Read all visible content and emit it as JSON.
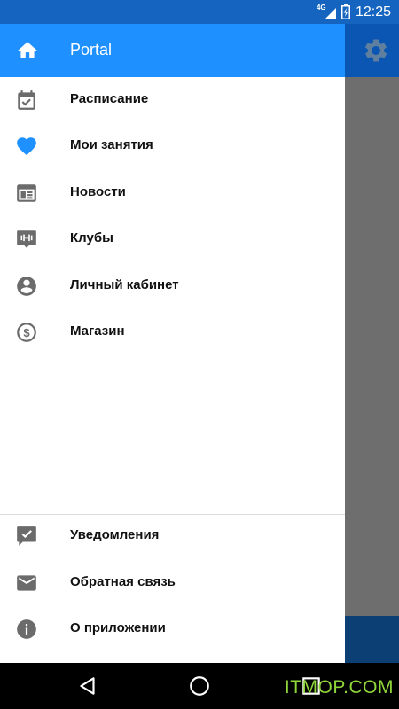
{
  "status_bar": {
    "network": "4G",
    "time": "12:25",
    "icons": [
      "signal-icon",
      "battery-charging-icon"
    ]
  },
  "drawer": {
    "header": {
      "title": "Portal",
      "icon": "home-icon"
    },
    "items": [
      {
        "label": "Расписание",
        "icon": "calendar-check-icon"
      },
      {
        "label": "Мои занятия",
        "icon": "heart-icon"
      },
      {
        "label": "Новости",
        "icon": "newspaper-icon"
      },
      {
        "label": "Клубы",
        "icon": "fitness-club-icon"
      },
      {
        "label": "Личный кабинет",
        "icon": "account-circle-icon"
      },
      {
        "label": "Магазин",
        "icon": "dollar-circle-icon"
      }
    ],
    "footer_items": [
      {
        "label": "Уведомления",
        "icon": "notification-check-icon"
      },
      {
        "label": "Обратная связь",
        "icon": "mail-icon"
      },
      {
        "label": "О приложении",
        "icon": "info-icon"
      }
    ]
  },
  "background": {
    "settings_icon": "gear-icon"
  },
  "nav_bar": {
    "buttons": [
      "back-icon",
      "home-circle-icon",
      "recents-icon"
    ]
  },
  "watermark": "ITMOP.COM",
  "colors": {
    "status_bar": "#1565c0",
    "drawer_header": "#1e90ff",
    "accent_icon": "#1e90ff",
    "icon_gray": "#6b6b6b",
    "scrim": "#6e6e6e",
    "watermark": "#8fd63a"
  }
}
